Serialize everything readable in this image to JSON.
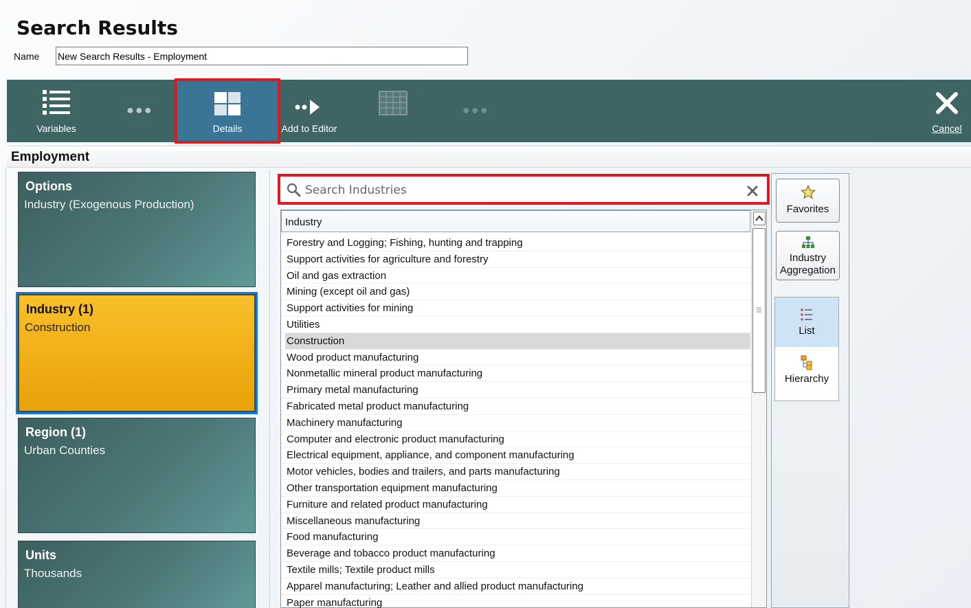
{
  "page": {
    "title": "Search Results"
  },
  "name_field": {
    "label": "Name",
    "value": "New Search Results - Employment"
  },
  "toolbar": {
    "variables_label": "Variables",
    "details_label": "Details",
    "add_to_editor_label": "Add to Editor",
    "cancel_label": "Cancel",
    "background_color": "#3f6464",
    "highlight_color": "#e0191f"
  },
  "section": {
    "title": "Employment"
  },
  "cards": [
    {
      "title": "Options",
      "value": "Industry (Exogenous Production)"
    },
    {
      "title": "Industry (1)",
      "value": "Construction"
    },
    {
      "title": "Region (1)",
      "value": "Urban Counties"
    },
    {
      "title": "Units",
      "value": "Thousands"
    }
  ],
  "search": {
    "placeholder": "Search Industries"
  },
  "list": {
    "header": "Industry",
    "selected": "Construction",
    "rows": [
      "Forestry and Logging; Fishing, hunting and trapping",
      "Support activities for agriculture and forestry",
      "Oil and gas extraction",
      "Mining (except oil and gas)",
      "Support activities for mining",
      "Utilities",
      "Construction",
      "Wood product manufacturing",
      "Nonmetallic mineral product manufacturing",
      "Primary metal manufacturing",
      "Fabricated metal product manufacturing",
      "Machinery manufacturing",
      "Computer and electronic product manufacturing",
      "Electrical equipment, appliance, and component manufacturing",
      "Motor vehicles, bodies and trailers, and parts manufacturing",
      "Other transportation equipment manufacturing",
      "Furniture and related product manufacturing",
      "Miscellaneous manufacturing",
      "Food manufacturing",
      "Beverage and tobacco product manufacturing",
      "Textile mills; Textile product mills",
      "Apparel manufacturing; Leather and allied product manufacturing",
      "Paper manufacturing"
    ]
  },
  "side": {
    "favorites": "Favorites",
    "aggregation_line1": "Industry",
    "aggregation_line2": "Aggregation",
    "list_view": "List",
    "hierarchy_view": "Hierarchy"
  }
}
